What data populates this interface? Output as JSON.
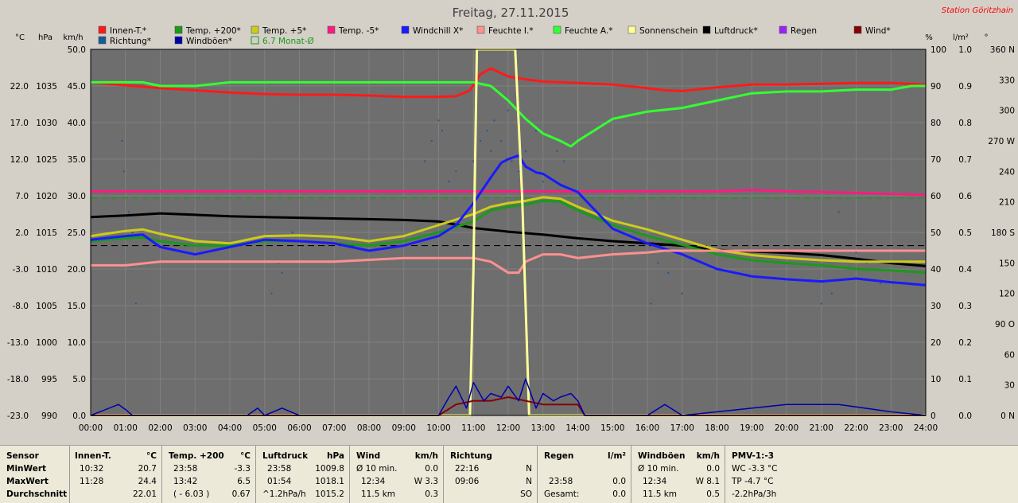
{
  "title": "Freitag, 27.11.2015",
  "station": "Station Göritzhain",
  "colors": {
    "background": "#6e6e6e",
    "innen": "#ff1a1a",
    "temp200": "#1a9a1a",
    "temp5": "#cccc1a",
    "tempm5": "#ff1a80",
    "windchill": "#1a1aff",
    "feuchte_i": "#ff9090",
    "feuchte_a": "#33ff33",
    "sonne": "#ffff99",
    "luftdruck": "#000000",
    "regen": "#9922ff",
    "wind": "#880000",
    "richtung": "#1a5a9a",
    "windboeen": "#0000aa",
    "avg": "#1a9a1a"
  },
  "legend": {
    "row1": [
      {
        "label": "Innen-T.*",
        "color": "#ff1a1a"
      },
      {
        "label": "Temp. +200*",
        "color": "#1a9a1a"
      },
      {
        "label": "Temp. +5*",
        "color": "#cccc1a"
      },
      {
        "label": "Temp. -5*",
        "color": "#ff1a80"
      },
      {
        "label": "Windchill X*",
        "color": "#1a1aff"
      },
      {
        "label": "Feuchte I.*",
        "color": "#ff9090"
      },
      {
        "label": "Feuchte A.*",
        "color": "#33ff33"
      },
      {
        "label": "Sonnenschein",
        "color": "#ffff99"
      },
      {
        "label": "Luftdruck*",
        "color": "#000000"
      },
      {
        "label": "Regen",
        "color": "#9922ff"
      },
      {
        "label": "Wind*",
        "color": "#880000"
      }
    ],
    "row2": [
      {
        "label": "Richtung*",
        "color": "#1a5a9a"
      },
      {
        "label": "Windböen*",
        "color": "#0000aa"
      },
      {
        "label": "6.7 Monat-Ø",
        "color": "#1a9a1a"
      }
    ]
  },
  "axis_units": {
    "c": "°C",
    "hpa": "hPa",
    "kmh": "km/h",
    "pct": "%",
    "lm2": "l/m²",
    "deg": "°"
  },
  "chart_data": {
    "type": "line",
    "x_unit": "hours",
    "xlim": [
      0,
      24
    ],
    "x_ticks": [
      "00:00",
      "01:00",
      "02:00",
      "03:00",
      "04:00",
      "05:00",
      "06:00",
      "07:00",
      "08:00",
      "09:00",
      "10:00",
      "11:00",
      "12:00",
      "13:00",
      "14:00",
      "15:00",
      "16:00",
      "17:00",
      "18:00",
      "19:00",
      "20:00",
      "21:00",
      "22:00",
      "23:00",
      "24:00"
    ],
    "axes": {
      "temperature_c": {
        "range": [
          -23,
          27
        ],
        "ticks": [
          "22.0",
          "17.0",
          "12.0",
          "7.0",
          "2.0",
          "-3.0",
          "-8.0",
          "-13.0",
          "-18.0",
          "-23.0"
        ]
      },
      "pressure_hpa": {
        "range": [
          990,
          1040
        ],
        "ticks": [
          "1035",
          "1030",
          "1025",
          "1020",
          "1015",
          "1010",
          "1005",
          "1000",
          "995",
          "990"
        ]
      },
      "speed_kmh": {
        "range": [
          0,
          50
        ],
        "ticks": [
          "50.0",
          "45.0",
          "40.0",
          "35.0",
          "30.0",
          "25.0",
          "20.0",
          "15.0",
          "10.0",
          "5.0",
          "0.0"
        ]
      },
      "humidity_pct": {
        "range": [
          0,
          100
        ],
        "ticks": [
          "100",
          "90",
          "80",
          "70",
          "60",
          "50",
          "40",
          "30",
          "20",
          "10",
          "0"
        ]
      },
      "rain_lm2": {
        "range": [
          0,
          1
        ],
        "ticks": [
          "1.0",
          "0.9",
          "0.8",
          "0.7",
          "0.6",
          "0.5",
          "0.4",
          "0.3",
          "0.2",
          "0.1",
          "0.0"
        ]
      },
      "direction_deg": {
        "range": [
          0,
          360
        ],
        "ticks": [
          "360 N",
          "330",
          "300",
          "270 W",
          "240",
          "210",
          "180 S",
          "150",
          "120",
          "90 O",
          "60",
          "30",
          "0 N"
        ]
      }
    },
    "series": [
      {
        "name": "Innen-T.*",
        "axis": "temperature_c",
        "x": [
          0,
          1,
          2,
          3,
          4,
          5,
          6,
          7,
          8,
          9,
          10,
          10.5,
          10.9,
          11.2,
          11.5,
          12,
          12.5,
          13,
          14,
          15,
          16,
          16.5,
          17,
          18,
          19,
          20,
          21,
          22,
          23,
          24
        ],
        "y": [
          22.5,
          22.1,
          21.7,
          21.4,
          21.1,
          20.9,
          20.8,
          20.8,
          20.7,
          20.5,
          20.5,
          20.6,
          21.4,
          23.6,
          24.4,
          23.3,
          22.9,
          22.6,
          22.4,
          22.2,
          21.7,
          21.4,
          21.3,
          21.8,
          22.2,
          22.2,
          22.3,
          22.4,
          22.4,
          22.2
        ]
      },
      {
        "name": "Feuchte A.*",
        "axis": "humidity_pct",
        "x": [
          0,
          1,
          1.5,
          2,
          3,
          4,
          5,
          6,
          7,
          8,
          9,
          10,
          11,
          11.5,
          12,
          12.5,
          13,
          13.5,
          13.8,
          14,
          14.5,
          15,
          16,
          17,
          18,
          19,
          20,
          21,
          22,
          23,
          23.6,
          24
        ],
        "y": [
          91,
          91,
          91,
          90,
          90,
          91,
          91,
          91,
          91,
          91,
          91,
          91,
          91,
          90,
          86,
          81,
          77,
          75,
          73.5,
          75,
          78,
          81,
          83,
          84,
          86,
          88,
          88.5,
          88.5,
          89,
          89,
          90,
          90
        ]
      },
      {
        "name": "Temp. -5*",
        "axis": "temperature_c",
        "x": [
          0,
          2,
          4,
          6,
          8,
          10,
          12,
          14,
          16,
          18,
          19,
          20,
          22,
          24
        ],
        "y": [
          7.6,
          7.6,
          7.6,
          7.6,
          7.6,
          7.6,
          7.6,
          7.6,
          7.6,
          7.6,
          7.8,
          7.6,
          7.4,
          7.1
        ]
      },
      {
        "name": "Luftdruck*",
        "axis": "pressure_hpa",
        "x": [
          0,
          1,
          2,
          3,
          4,
          5,
          6,
          7,
          8,
          9,
          10,
          11,
          12,
          13,
          14,
          15,
          16,
          17,
          18,
          19,
          20,
          21,
          22,
          23,
          24
        ],
        "y": [
          1017.1,
          1017.3,
          1017.6,
          1017.4,
          1017.2,
          1017.1,
          1017.0,
          1016.9,
          1016.8,
          1016.7,
          1016.5,
          1015.6,
          1015.1,
          1014.7,
          1014.2,
          1013.8,
          1013.5,
          1013.2,
          1012.6,
          1012.4,
          1012.2,
          1011.9,
          1011.4,
          1010.8,
          1010.4
        ]
      },
      {
        "name": "Temp. +5*",
        "axis": "temperature_c",
        "x": [
          0,
          1,
          1.5,
          2,
          3,
          4,
          5,
          6,
          7,
          8,
          9,
          10,
          11,
          11.5,
          12,
          12.5,
          13,
          13.5,
          14,
          15,
          16,
          17,
          18,
          19,
          20,
          21,
          22,
          23,
          24
        ],
        "y": [
          1.5,
          2.2,
          2.4,
          1.8,
          0.8,
          0.5,
          1.5,
          1.6,
          1.4,
          0.8,
          1.5,
          3.0,
          4.5,
          5.5,
          6.0,
          6.3,
          6.8,
          6.6,
          5.5,
          3.6,
          2.4,
          1.0,
          -0.4,
          -1.1,
          -1.5,
          -1.8,
          -2.0,
          -2.0,
          -2.0
        ]
      },
      {
        "name": "Temp. +200*",
        "axis": "temperature_c",
        "x": [
          0,
          1,
          1.5,
          2,
          3,
          4,
          5,
          6,
          7,
          8,
          9,
          10,
          11,
          11.5,
          12,
          12.5,
          13,
          13.5,
          14,
          15,
          16,
          17,
          18,
          19,
          20,
          21,
          22,
          23,
          24
        ],
        "y": [
          0.8,
          1.2,
          1.3,
          0.8,
          0.2,
          0.2,
          0.8,
          0.8,
          0.5,
          0.2,
          0.8,
          2.0,
          3.5,
          5.0,
          5.5,
          5.8,
          6.3,
          6.2,
          5.0,
          3.0,
          1.5,
          0.3,
          -1.0,
          -1.8,
          -2.2,
          -2.5,
          -3.0,
          -3.2,
          -3.5
        ]
      },
      {
        "name": "Windchill X*",
        "axis": "temperature_c",
        "x": [
          0,
          1,
          1.5,
          2,
          2.5,
          3,
          4,
          5,
          6,
          7,
          8,
          9,
          10,
          10.5,
          11,
          11.5,
          11.8,
          12,
          12.3,
          12.5,
          12.8,
          13,
          13.5,
          14,
          14.5,
          15,
          16,
          17,
          18,
          19,
          20,
          21,
          22,
          23,
          24
        ],
        "y": [
          1.0,
          1.5,
          1.7,
          0.0,
          -0.5,
          -1.0,
          0.0,
          1.0,
          0.8,
          0.5,
          -0.5,
          0.2,
          1.5,
          3.0,
          6.0,
          9.5,
          11.5,
          12.0,
          12.5,
          11.0,
          10.2,
          10.0,
          8.5,
          7.5,
          5.0,
          2.5,
          0.5,
          -1.0,
          -3.0,
          -4.0,
          -4.4,
          -4.7,
          -4.3,
          -4.8,
          -5.2
        ]
      },
      {
        "name": "Feuchte I.*",
        "axis": "humidity_pct",
        "x": [
          0,
          1,
          2,
          3,
          4,
          5,
          6,
          7,
          8,
          9,
          10,
          10.5,
          11,
          11.5,
          12,
          12.3,
          12.5,
          13,
          13.5,
          14,
          15,
          16,
          16.5,
          17,
          18,
          24
        ],
        "y": [
          41,
          41,
          42,
          42,
          42,
          42,
          42,
          42,
          42.5,
          43,
          43,
          43,
          43,
          42,
          39,
          39,
          42,
          44,
          44,
          43,
          44,
          44.5,
          45,
          45,
          45,
          45
        ]
      },
      {
        "name": "Sonnenschein",
        "axis": "speed_kmh",
        "x": [
          0,
          10.9,
          11.0,
          11.1,
          11.2,
          12.2,
          12.4,
          12.6,
          24
        ],
        "y": [
          0,
          0,
          20,
          50,
          50,
          50,
          30,
          0,
          0
        ]
      },
      {
        "name": "Wind*",
        "axis": "speed_kmh",
        "x": [
          0,
          10,
          10.5,
          11,
          11.5,
          12,
          12.5,
          13,
          13.5,
          14,
          14.2,
          24
        ],
        "y": [
          0,
          0,
          1.5,
          2.0,
          2.0,
          2.5,
          2.0,
          1.5,
          1.5,
          1.5,
          0,
          0
        ]
      },
      {
        "name": "Windböen*",
        "axis": "speed_kmh",
        "x": [
          0,
          0.8,
          1.0,
          1.2,
          2,
          4.5,
          4.8,
          5,
          5.5,
          6,
          10,
          10.3,
          10.5,
          10.8,
          11.0,
          11.3,
          11.5,
          11.8,
          12.0,
          12.3,
          12.5,
          12.8,
          13.0,
          13.3,
          13.5,
          13.8,
          14.0,
          14.2,
          16,
          16.5,
          17,
          20,
          21.5,
          23,
          24
        ],
        "y": [
          0,
          1.5,
          0.8,
          0,
          0,
          0,
          1,
          0,
          1,
          0,
          0,
          2.5,
          4.0,
          1.0,
          4.5,
          2.0,
          3.0,
          2.5,
          4.0,
          2.0,
          5.0,
          1.0,
          3.0,
          2.0,
          2.5,
          3.0,
          2.0,
          0,
          0,
          1.5,
          0,
          1.5,
          1.5,
          0.5,
          0
        ]
      }
    ],
    "reference_lines": [
      {
        "name": "6.7 Monat-Ø",
        "axis": "temperature_c",
        "value": 6.7,
        "style": "dashed",
        "color": "#1a9a1a"
      },
      {
        "name": "",
        "axis": "pressure_hpa",
        "value": 1013.2,
        "style": "dashed",
        "color": "#000000"
      }
    ],
    "scatter": {
      "name": "Richtung*",
      "axis": "direction_deg",
      "x": [
        0.9,
        0.95,
        1.1,
        1.2,
        1.3,
        5.2,
        5.4,
        5.5,
        5.8,
        6.1,
        9.6,
        9.8,
        10.0,
        10.1,
        10.3,
        10.5,
        10.8,
        11.0,
        11.2,
        11.4,
        11.5,
        11.6,
        11.8,
        12.0,
        12.1,
        12.3,
        12.5,
        12.8,
        13.0,
        13.4,
        13.6,
        16.1,
        16.3,
        16.6,
        17.0,
        20.1,
        21.0,
        21.3,
        21.5,
        22.0,
        22.3,
        22.7
      ],
      "y": [
        270,
        240,
        200,
        180,
        110,
        120,
        150,
        140,
        180,
        220,
        250,
        270,
        290,
        280,
        230,
        240,
        220,
        250,
        270,
        280,
        260,
        290,
        270,
        300,
        250,
        240,
        260,
        280,
        230,
        260,
        250,
        110,
        150,
        140,
        120,
        160,
        110,
        120,
        200,
        160,
        150,
        130
      ]
    },
    "title": "Freitag, 27.11.2015",
    "grid": true,
    "legend_position": "top"
  },
  "stats": {
    "col0": {
      "h": "Sensor",
      "r1": "MinWert",
      "r2": "MaxWert",
      "r3": "Durchschnitt"
    },
    "col1": {
      "h": "Innen-T.",
      "u": "°C",
      "r1a": "10:32",
      "r1b": "20.7",
      "r2a": "11:28",
      "r2b": "24.4",
      "r3a": "",
      "r3b": "22.01"
    },
    "col2": {
      "h": "Temp. +200",
      "u": "°C",
      "r1a": "23:58",
      "r1b": "-3.3",
      "r2a": "13:42",
      "r2b": "6.5",
      "r3a": "( - 6.03 )",
      "r3b": "0.67"
    },
    "col3": {
      "h": "Luftdruck",
      "u": "hPa",
      "r1a": "23:58",
      "r1b": "1009.8",
      "r2a": "01:54",
      "r2b": "1018.1",
      "r3a": "^1.2hPa/h",
      "r3b": "1015.2"
    },
    "col4": {
      "h": "Wind",
      "u": "km/h",
      "r1a": "Ø 10 min.",
      "r1b": "0.0",
      "r2a": "12:34",
      "r2b": "W 3.3",
      "r3a": "11.5 km",
      "r3b": "0.3"
    },
    "col5": {
      "h": "Richtung",
      "u": "",
      "r1a": "22:16",
      "r1b": "N",
      "r2a": "09:06",
      "r2b": "N",
      "r3a": "",
      "r3b": "SO"
    },
    "col6": {
      "h": "Regen",
      "u": "l/m²",
      "r1a": "",
      "r1b": "",
      "r2a": "23:58",
      "r2b": "0.0",
      "r3a": "Gesamt:",
      "r3b": "0.0"
    },
    "col6b": {
      "r2c": "0.0"
    },
    "col7": {
      "h": "Windböen",
      "u": "km/h",
      "r1a": "Ø 10 min.",
      "r1b": "0.0",
      "r2a": "12:34",
      "r2b": "W 8.1",
      "r3a": "11.5 km",
      "r3b": "0.5"
    },
    "col8": {
      "h": "PMV-1:-3",
      "r1": "WC -3.3 °C",
      "r2": "TP -4.7 °C",
      "r3": "-2.2hPa/3h"
    }
  }
}
